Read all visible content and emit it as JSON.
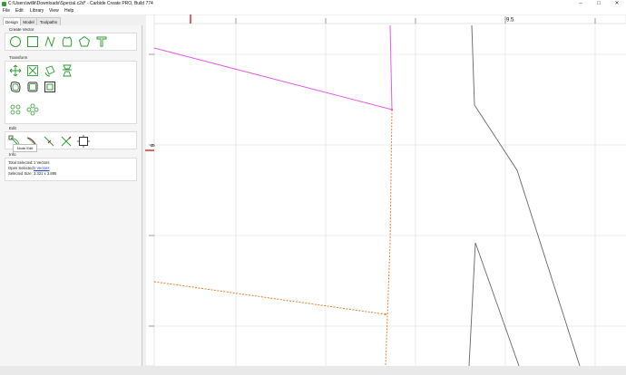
{
  "window": {
    "title": "C:\\Users\\willk\\Downloads\\Special.c2d* - Carbide Create PRO, Build 774",
    "minimize_glyph": "–",
    "maximize_glyph": "□",
    "close_glyph": "✕"
  },
  "menu": [
    "File",
    "Edit",
    "Library",
    "View",
    "Help"
  ],
  "tabs": [
    "Design",
    "Model",
    "Toolpaths"
  ],
  "active_tab": "Design",
  "sections": {
    "create_vector": "Create Vector",
    "transform": "Transform",
    "edit": "Edit",
    "info": "Info"
  },
  "create_vector_tools": [
    "circle-icon",
    "rectangle-icon",
    "curve-icon",
    "polygon-icon",
    "pentagon-icon",
    "text-icon"
  ],
  "transform_tools": [
    "move-icon",
    "scale-icon",
    "rotate-icon",
    "mirror-icon",
    "offset-icon",
    "join-icon",
    "boolean-icon",
    "align-icon",
    "array-icon"
  ],
  "edit_tools": [
    "node-edit-icon",
    "smooth-icon",
    "fillet-icon",
    "trim-icon",
    "extend-icon"
  ],
  "tooltip": "Node Edit",
  "info": {
    "total_selected_label": "Total Selected:",
    "total_selected_value": "1 Vectors",
    "open_selected_label": "Open Selected:",
    "open_selected_value": "1 Vectors",
    "selected_size_label": "Selected Size:",
    "selected_size_value": "3.321 x 3.895"
  },
  "canvas": {
    "ruler_top_label": "9.5",
    "ruler_left_label": "6",
    "colors": {
      "selected_path": "#e65be6",
      "toolpath": "#f07d28",
      "vector": "#666666",
      "grid": "#d9d9d9",
      "marker": "#d00000"
    }
  }
}
